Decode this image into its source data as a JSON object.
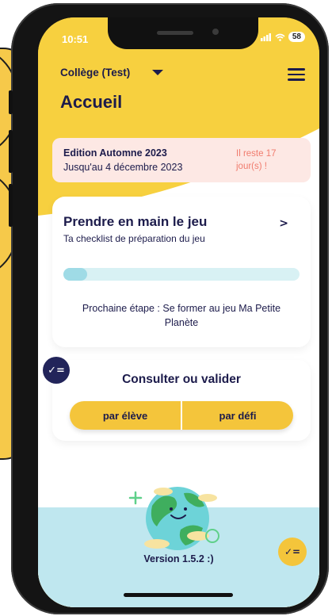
{
  "status_bar": {
    "time": "10:51",
    "battery": "58"
  },
  "header": {
    "school_name": "Collège (Test)",
    "page_title": "Accueil"
  },
  "edition_alert": {
    "title": "Edition Automne 2023",
    "date": "Jusqu'au 4 décembre 2023",
    "remaining_line1": "Il reste 17",
    "remaining_line2": "jour(s) !"
  },
  "checklist_card": {
    "title": "Prendre en main le jeu",
    "subtitle": "Ta checklist de préparation du jeu",
    "chevron": ">",
    "progress_fraction": 0.1,
    "next_step": "Prochaine étape : Se former au jeu Ma Petite Planète"
  },
  "validate_card": {
    "title": "Consulter ou valider",
    "buttons": [
      "par élève",
      "par défi"
    ]
  },
  "footer": {
    "version": "Version 1.5.2 :)"
  },
  "colors": {
    "yellow": "#f7d03f",
    "navy": "#1c1b4b",
    "alert_bg": "#fde8e4",
    "alert_text": "#f07c6e",
    "footer_blue": "#bfe7ef"
  }
}
